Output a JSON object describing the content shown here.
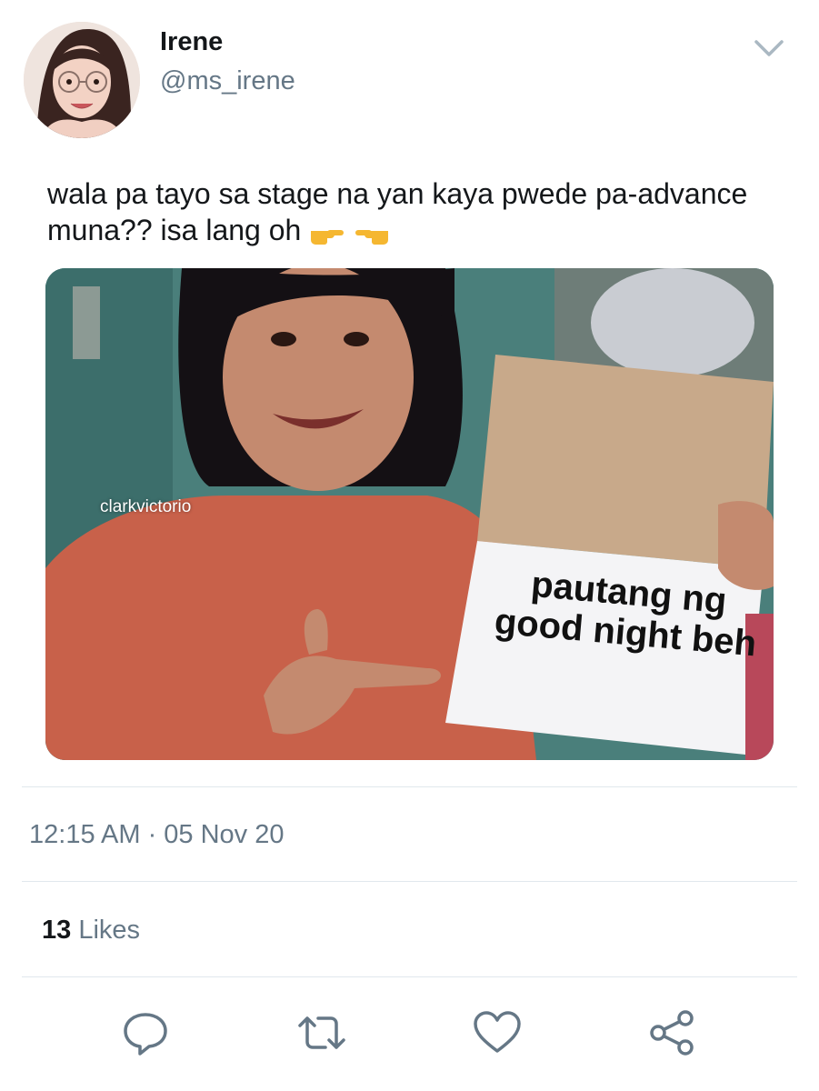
{
  "author": {
    "display_name": "Irene",
    "handle": "@ms_irene"
  },
  "tweet": {
    "text": "wala pa tayo sa stage na yan kaya pwede pa-advance muna?? isa lang oh",
    "emoji": [
      "right-pointing-hand-icon",
      "left-pointing-hand-icon"
    ]
  },
  "media": {
    "watermark": "clarkvictorio",
    "sign_text": "pautang ng good night beh"
  },
  "meta": {
    "timestamp": "12:15 AM · 05 Nov 20",
    "likes_count": "13",
    "likes_label": "Likes"
  },
  "actions": [
    "reply-icon",
    "retweet-icon",
    "like-icon",
    "share-icon"
  ],
  "colors": {
    "text_primary": "#14171a",
    "text_secondary": "#657786",
    "divider": "#e1e8ed",
    "icon": "#657786"
  }
}
